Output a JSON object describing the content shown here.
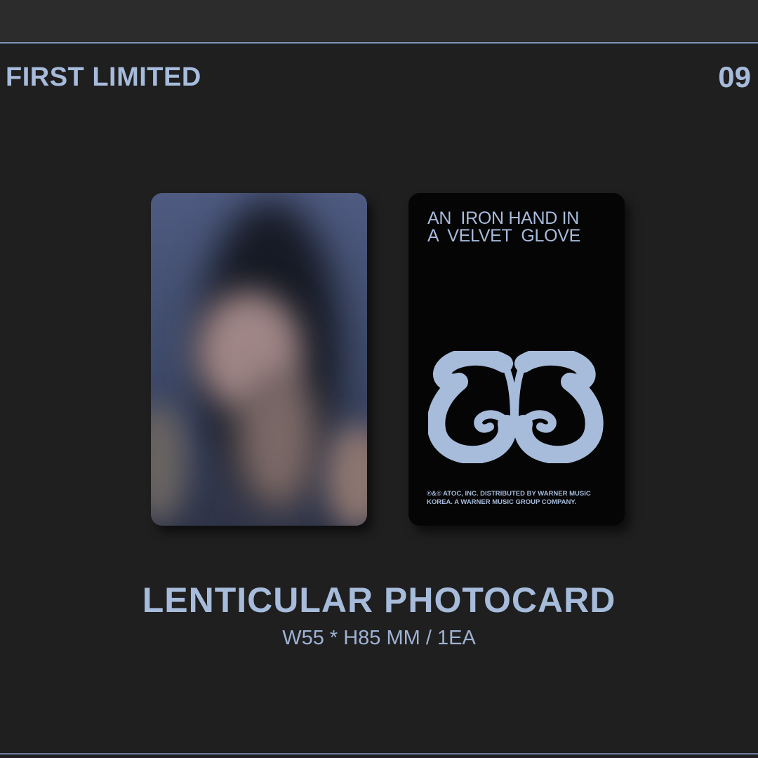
{
  "colors": {
    "accent": "#a7bbdb",
    "background": "#1f1f20",
    "rule": "#7f93b6",
    "card_back": "#050505"
  },
  "header": {
    "left_label": "FIRST LIMITED",
    "right_number": "09"
  },
  "photocard_back": {
    "title_line1": "AN  IRON HAND IN",
    "title_line2": "A  VELVET  GLOVE",
    "logo_icon": "butterfly-monogram-icon",
    "copyright_line1": "℗&© ATOC, INC. DISTRIBUTED BY WARNER MUSIC",
    "copyright_line2": "KOREA. A WARNER MUSIC GROUP COMPANY."
  },
  "product": {
    "name": "LENTICULAR PHOTOCARD",
    "spec": "W55 * H85 MM / 1EA"
  }
}
